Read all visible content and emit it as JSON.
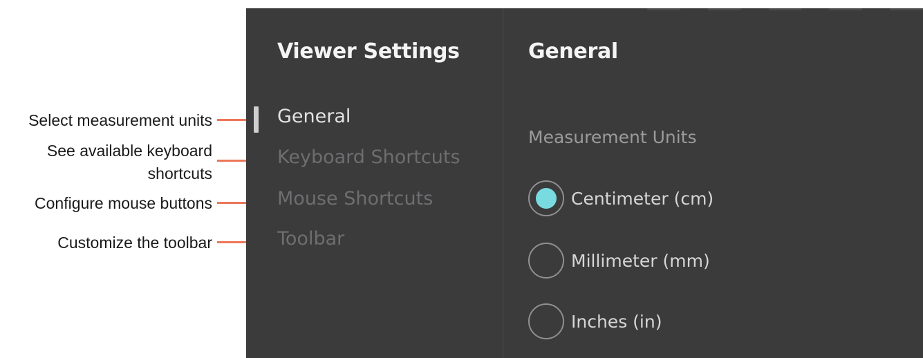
{
  "callouts": [
    {
      "text": "Select measurement units"
    },
    {
      "text": "See available keyboard\nshortcuts"
    },
    {
      "text": "Configure mouse buttons"
    },
    {
      "text": "Customize the toolbar"
    }
  ],
  "sidebar": {
    "title": "Viewer Settings",
    "items": [
      {
        "label": "General",
        "active": true
      },
      {
        "label": "Keyboard Shortcuts",
        "active": false
      },
      {
        "label": "Mouse Shortcuts",
        "active": false
      },
      {
        "label": "Toolbar",
        "active": false
      }
    ]
  },
  "main": {
    "title": "General",
    "measurement": {
      "label": "Measurement Units",
      "options": [
        {
          "label": "Centimeter (cm)",
          "selected": true
        },
        {
          "label": "Millimeter (mm)",
          "selected": false
        },
        {
          "label": "Inches (in)",
          "selected": false
        }
      ]
    }
  },
  "colors": {
    "panel_background": "#3b3b3c",
    "callout_line": "#ec7659",
    "radio_selected": "#79dbe0",
    "inactive_text": "#6e6e70"
  }
}
